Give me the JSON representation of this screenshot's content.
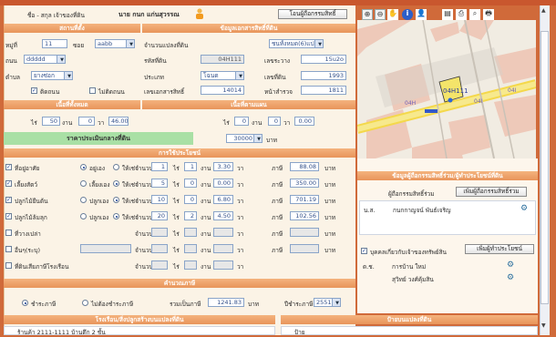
{
  "header": {
    "name_label": "ชื่อ - สกุล เจ้าของที่ดิน",
    "owner_name": "นาย กนก แก่นสุวรรณ",
    "transfer_btn": "โอนผู้ถือกรรมสิทธิ์"
  },
  "toolbar": {
    "icons": [
      "zoom-in-icon",
      "zoom-out-icon",
      "pan-hand-icon",
      "info-icon",
      "user-icon",
      "layers-icon",
      "print-icon",
      "binoculars-icon",
      "printer-icon"
    ],
    "glyphs": [
      "⊕",
      "⊖",
      "✋",
      "i",
      "👤",
      "▤",
      "⎙",
      "⌕",
      "🖶"
    ]
  },
  "location": {
    "title": "สถานที่ตั้ง",
    "moo_label": "หมู่ที่",
    "moo": "11",
    "soi_label": "ซอย",
    "soi": "aabb",
    "road_label": "ถนน",
    "road": "ddddd",
    "tambon_label": "ตำบล",
    "tambon": "ยางซ่อก"
  },
  "land_info": {
    "title": "ข้อมูลเอกสารสิทธิ์ที่ดิน",
    "count_label": "จำนวนแปลงที่ดิน",
    "count": "ชนทั้งหมด(6)แปลง",
    "parcel_code_label": "รหัสที่ดิน",
    "parcel_code": "04H111",
    "survey_label": "เลขระวาง",
    "survey": "15u2o",
    "type_label": "ประเภท",
    "type": "โฉนด",
    "land_no_label": "เลขที่ดิน",
    "land_no": "1993",
    "deed_label": "เลขเอกสารสิทธิ์",
    "deed": "14014",
    "page_label": "หน้าสำรวจ",
    "page": "1811",
    "cb1_label": "ติดถนน",
    "cb2_label": "ไม่ติดถนน"
  },
  "area": {
    "title1": "เนื้อที่ทั้งหมด",
    "title2": "เนื้อที่ตามแผน",
    "rai_label": "ไร่",
    "rai": "50",
    "ngan_label": "งาน",
    "ngan": "0",
    "wa_label": "วา",
    "wa": "46.00",
    "rai2": "0",
    "ngan2": "0",
    "wa2": "0.00"
  },
  "price": {
    "label": "ราคาประเมินกลางที่ดิน",
    "value": "30000",
    "unit": "บาท"
  },
  "usage": {
    "title": "การใช้ประโยชน์",
    "rows": [
      {
        "label": "ที่อยู่อาศัย",
        "checked": true,
        "opt1": "อยู่เอง",
        "opt2": "ให้เช่า",
        "rai": "1",
        "ngan": "1",
        "wa": "3.30",
        "tax": "88.08",
        "sel": 1
      },
      {
        "label": "เลี้ยงสัตว์",
        "checked": true,
        "opt1": "เลี้ยงเอง",
        "opt2": "ให้เช่า",
        "rai": "5",
        "ngan": "0",
        "wa": "0.00",
        "tax": "350.00",
        "sel": 2
      },
      {
        "label": "ปลูกไม้ยืนต้น",
        "checked": true,
        "opt1": "ปลูกเอง",
        "opt2": "ให้เช่า",
        "rai": "10",
        "ngan": "0",
        "wa": "6.80",
        "tax": "701.19",
        "sel": 2
      },
      {
        "label": "ปลูกไม้ล้มลุก",
        "checked": true,
        "opt1": "ปลูกเอง",
        "opt2": "ให้เช่า",
        "rai": "20",
        "ngan": "2",
        "wa": "4.50",
        "tax": "102.56",
        "sel": 2
      },
      {
        "label": "ที่วางเปล่า",
        "checked": false,
        "opt1": "",
        "opt2": "",
        "rai": "",
        "ngan": "",
        "wa": "",
        "tax": "",
        "sel": 0
      },
      {
        "label": "อื่นๆ(ระบุ)",
        "checked": false,
        "opt1": "",
        "opt2": "",
        "rai": "",
        "ngan": "",
        "wa": "",
        "tax": "",
        "sel": 0
      },
      {
        "label": "ที่ดินเสียภาษีโรงเรือน",
        "checked": false,
        "opt1": "",
        "opt2": "",
        "rai": "",
        "ngan": "",
        "wa": "",
        "tax": "",
        "sel": 0
      }
    ],
    "amount_label": "จำนวน",
    "rai_label": "ไร่",
    "ngan_label": "งาน",
    "wa_label": "วา",
    "tax_label": "ภาษี",
    "baht": "บาท"
  },
  "calc": {
    "title": "คำนวณภาษี",
    "opt_pay": "ชำระภาษี",
    "opt_nopay": "ไม่ต้องชำระภาษี",
    "total_label": "รวมเป็นภาษี",
    "total": "1241.83",
    "unit": "บาท",
    "year_label": "ปีชำระภาษี",
    "year": "2551"
  },
  "bottom": {
    "left_title": "โรงเรือน/สิ่งปลูกสร้างบนแปลงที่ดิน",
    "right_title": "ป้ายบนแปลงที่ดิน",
    "left_row": "ร้านค้า 2111-1111 บ้านตึก 2 ชั้น",
    "right_row": "ป้าย"
  },
  "map": {
    "parcel_label": "04H111",
    "lot1": "04H",
    "lot2": "04I",
    "lot3": "04I"
  },
  "owners": {
    "title": "ข้อมูลผู้ถือกรรมสิทธิ์ร่วม/ผู้ทำประโยชน์ที่ดิน",
    "co_label": "ผู้ถือกรรมสิทธิ์ร่วม",
    "add_btn": "เพิ่มผู้ถือกรรมสิทธิ์ร่วม",
    "co_rows": [
      {
        "title": "น.ส.",
        "name": "กนกกาญจน์ พันธ์เจริญ"
      }
    ],
    "persons_label": "บุคคลเกี่ยวกับเจ้าของทรัพย์สิน",
    "persons_btn": "เพิ่มผู้ทำประโยชน์",
    "persons": [
      {
        "title": "ด.ช.",
        "name": "การบ้าน ใหม่"
      },
      {
        "title": "",
        "name": "สุวิทย์ วงศ์คุ้มสิน"
      }
    ]
  },
  "colors": {
    "accent": "#e8945a",
    "green": "#a9e0a5",
    "parcel": "#f4e46a"
  }
}
